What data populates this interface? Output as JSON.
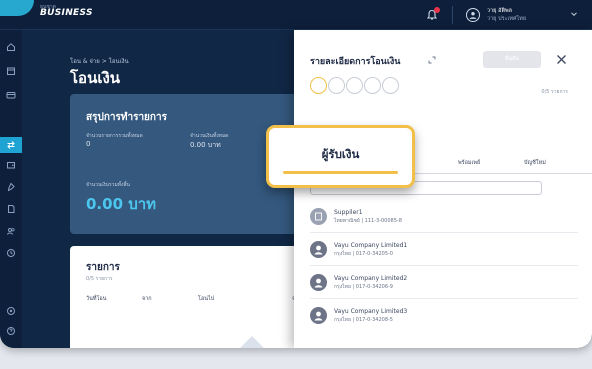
{
  "topbar": {
    "brand_small": "ธนชาต",
    "brand": "BUSINESS",
    "user_name": "วายุ อัติพล",
    "user_company": "วายุ ประเทศไทย"
  },
  "colors": {
    "accent": "#1ea3d2",
    "highlight": "#f2c04a",
    "navy": "#0f2340",
    "amount": "#4dc6ee"
  },
  "page": {
    "breadcrumb": "โอน & จ่าย > โอนเงิน",
    "title": "โอนเงิน"
  },
  "summary": {
    "title": "สรุปการทำรายการ",
    "count_label": "จำนวนรายการรวมทั้งหมด",
    "count_value": "0",
    "fee_label": "จำนวนเงินทั้งหมด",
    "fee_value": "0.00 บาท",
    "total_label": "จำนวนเงินรวมทั้งสิ้น",
    "total_value": "0.00 บาท"
  },
  "list": {
    "title": "รายการ",
    "subtitle": "0/5 รายการ",
    "columns": [
      "วันที่โอน",
      "จาก",
      "โอนไป",
      "จ"
    ]
  },
  "panel": {
    "title": "รายละเอียดการโอนเงิน",
    "confirm_label": "ยืนยัน",
    "step_count": "0/5 รายการ",
    "tabs": [
      "พร้อมเพย์",
      "บัญชีใหม่"
    ],
    "recipients": [
      {
        "name": "Suppiler1",
        "account": "ไทยพาณิชย์ | 111-3-00085-8",
        "icon": "building-icon"
      },
      {
        "name": "Vayu Company Limited1",
        "account": "กรุงไทย | 017-0-34205-0",
        "icon": "user-icon"
      },
      {
        "name": "Vayu Company Limited2",
        "account": "กรุงไทย | 017-0-34206-9",
        "icon": "user-icon"
      },
      {
        "name": "Vayu Company Limited3",
        "account": "กรุงไทย | 017-0-34208-5",
        "icon": "user-icon"
      }
    ]
  },
  "callout": {
    "label": "ผู้รับเงิน"
  }
}
